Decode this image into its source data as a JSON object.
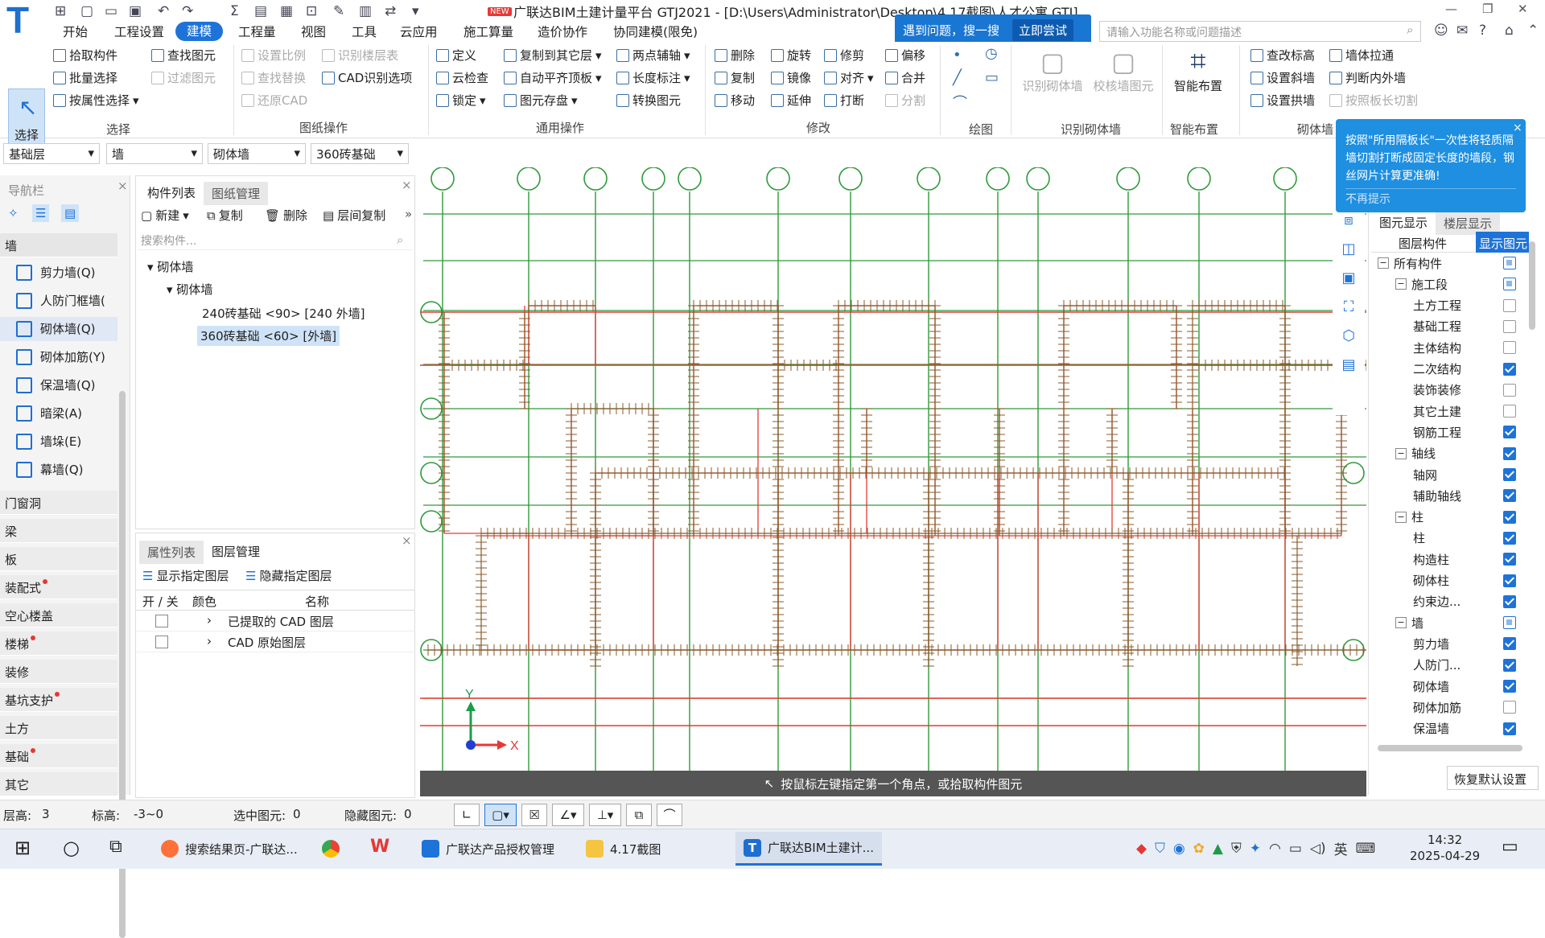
{
  "titlebar": {
    "app_title": "广联达BIM土建计量平台 GTJ2021 - [D:\\Users\\Administrator\\Desktop\\4.17截图\\人才公寓.GTJ]",
    "new_badge": "NEW",
    "menus": [
      "开始",
      "工程设置",
      "建模",
      "工程量",
      "视图",
      "工具",
      "云应用",
      "施工算量",
      "造价协作",
      "协同建模(限免)"
    ],
    "active_menu": "建模",
    "tip_text": "遇到问题，搜一搜",
    "tip_try": "立即尝试",
    "search_placeholder": "请输入功能名称或问题描述"
  },
  "ribbon": {
    "select": "选择",
    "select_group": [
      "拾取构件",
      "批量选择",
      "按属性选择"
    ],
    "select_group2": [
      "查找图元",
      "过滤图元"
    ],
    "drawing_ops": [
      "设置比例",
      "识别楼层表",
      "查找替换",
      "CAD识别选项",
      "还原CAD"
    ],
    "general_ops": [
      "定义",
      "复制到其它层",
      "两点辅轴",
      "云检查",
      "自动平齐顶板",
      "长度标注",
      "锁定",
      "图元存盘",
      "转换图元"
    ],
    "modify_ops": [
      "删除",
      "旋转",
      "修剪",
      "偏移",
      "复制",
      "镜像",
      "对齐",
      "合并",
      "移动",
      "延伸",
      "打断",
      "分割"
    ],
    "recog": [
      "识别砌体墙",
      "校核墙图元"
    ],
    "smart": "智能布置",
    "wall_ops": [
      "查改标高",
      "墙体拉通",
      "设置斜墙",
      "判断内外墙",
      "设置拱墙",
      "按照板长切割"
    ],
    "groups": [
      "选择",
      "图纸操作",
      "通用操作",
      "修改",
      "绘图",
      "识别砌体墙",
      "智能布置",
      "砌体墙"
    ]
  },
  "combos": [
    "基础层",
    "墙",
    "砌体墙",
    "360砖基础"
  ],
  "nav": {
    "title": "导航栏",
    "category_wall": "墙",
    "wall_items": [
      "剪力墙(Q)",
      "人防门框墙(",
      "砌体墙(Q)",
      "砌体加筋(Y)",
      "保温墙(Q)",
      "暗梁(A)",
      "墙垛(E)",
      "幕墙(Q)"
    ],
    "categories": [
      "门窗洞",
      "梁",
      "板",
      "装配式",
      "空心楼盖",
      "楼梯",
      "装修",
      "基坑支护",
      "土方",
      "基础",
      "其它"
    ]
  },
  "components": {
    "tabs": [
      "构件列表",
      "图纸管理"
    ],
    "toolbar": [
      "新建",
      "复制",
      "删除",
      "层间复制"
    ],
    "search_placeholder": "搜索构件...",
    "tree_root": "砌体墙",
    "tree_child": "砌体墙",
    "items": [
      "240砖基础 <90> [240 外墙]",
      "360砖基础 <60> [外墙]"
    ]
  },
  "layers": {
    "tabs": [
      "属性列表",
      "图层管理"
    ],
    "show_btn": "显示指定图层",
    "hide_btn": "隐藏指定图层",
    "headers": [
      "开 / 关",
      "颜色",
      "名称"
    ],
    "rows": [
      "已提取的 CAD 图层",
      "CAD 原始图层"
    ]
  },
  "canvas": {
    "prompt": "按鼠标左键指定第一个角点，或拾取构件图元",
    "axis_x": "X",
    "axis_y": "Y"
  },
  "tooltip": {
    "text": "按照\"所用隔板长\"一次性将轻质隔墙切割打断成固定长度的墙段，钢丝网片计算更准确!",
    "dismiss": "不再提示"
  },
  "rpanel": {
    "tabs": [
      "图元显示",
      "楼层显示"
    ],
    "col_component": "图层构件",
    "col_show": "显示图元",
    "reset": "恢复默认设置",
    "rows": [
      {
        "label": "所有构件",
        "level": 0,
        "exp": true,
        "state": "part"
      },
      {
        "label": "施工段",
        "level": 1,
        "exp": true,
        "state": "part"
      },
      {
        "label": "土方工程",
        "level": 2,
        "state": "off"
      },
      {
        "label": "基础工程",
        "level": 2,
        "state": "off"
      },
      {
        "label": "主体结构",
        "level": 2,
        "state": "off"
      },
      {
        "label": "二次结构",
        "level": 2,
        "state": "on"
      },
      {
        "label": "装饰装修",
        "level": 2,
        "state": "off"
      },
      {
        "label": "其它土建",
        "level": 2,
        "state": "off"
      },
      {
        "label": "钢筋工程",
        "level": 2,
        "state": "on"
      },
      {
        "label": "轴线",
        "level": 1,
        "exp": true,
        "state": "on"
      },
      {
        "label": "轴网",
        "level": 2,
        "state": "on"
      },
      {
        "label": "辅助轴线",
        "level": 2,
        "state": "on"
      },
      {
        "label": "柱",
        "level": 1,
        "exp": true,
        "state": "on"
      },
      {
        "label": "柱",
        "level": 2,
        "state": "on"
      },
      {
        "label": "构造柱",
        "level": 2,
        "state": "on"
      },
      {
        "label": "砌体柱",
        "level": 2,
        "state": "on"
      },
      {
        "label": "约束边...",
        "level": 2,
        "state": "on"
      },
      {
        "label": "墙",
        "level": 1,
        "exp": true,
        "state": "part"
      },
      {
        "label": "剪力墙",
        "level": 2,
        "state": "on"
      },
      {
        "label": "人防门...",
        "level": 2,
        "state": "on"
      },
      {
        "label": "砌体墙",
        "level": 2,
        "state": "on"
      },
      {
        "label": "砌体加筋",
        "level": 2,
        "state": "off"
      },
      {
        "label": "保温墙",
        "level": 2,
        "state": "on"
      }
    ]
  },
  "status": {
    "floor_label": "层高:",
    "floor_value": "3",
    "elev_label": "标高:",
    "elev_value": "-3~0",
    "selected_label": "选中图元:",
    "selected_value": "0",
    "hidden_label": "隐藏图元:",
    "hidden_value": "0"
  },
  "taskbar": {
    "apps": [
      "搜索结果页-广联达...",
      "广联达产品授权管理",
      "4.17截图",
      "广联达BIM土建计..."
    ],
    "ime": "英",
    "time": "14:32",
    "date": "2025-04-29"
  },
  "colors": {
    "accent": "#1e73d8",
    "grid": "#2e9b3a",
    "wall": "#e53935",
    "rebar": "#8a5a2b"
  }
}
